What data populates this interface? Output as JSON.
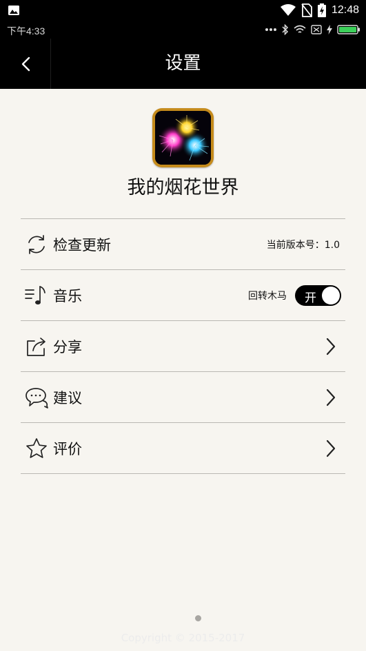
{
  "system_bar": {
    "time": "12:48",
    "left_icon": "image-icon",
    "icons": [
      "wifi-icon",
      "no-sim-icon",
      "battery-charging-icon"
    ]
  },
  "status_row": {
    "time": "下午4:33",
    "icons": [
      "more-dots-icon",
      "bluetooth-icon",
      "wifi-icon",
      "sim-off-icon",
      "charging-icon",
      "battery-icon"
    ],
    "battery_color": "#3cd05a"
  },
  "title_bar": {
    "title": "设置",
    "back_icon": "back-chevron-icon"
  },
  "app": {
    "name": "我的烟花世界",
    "icon": "fireworks-app-icon"
  },
  "rows": [
    {
      "icon": "refresh-icon",
      "label": "检查更新",
      "right_text": "当前版本号：1.0"
    },
    {
      "icon": "music-icon",
      "label": "音乐",
      "toggle_desc": "回转木马",
      "toggle_label": "开",
      "toggle_on": true
    },
    {
      "icon": "share-icon",
      "label": "分享",
      "chevron": "chevron-right-icon"
    },
    {
      "icon": "chat-icon",
      "label": "建议",
      "chevron": "chevron-right-icon"
    },
    {
      "icon": "star-icon",
      "label": "评价",
      "chevron": "chevron-right-icon"
    }
  ],
  "footer": {
    "copyright": "Copyright © 2015-2017"
  },
  "colors": {
    "bar_background": "#000000",
    "page_background": "#f7f5f0",
    "divider": "#b9b7b2",
    "icon_frame": "#c58b1c"
  }
}
